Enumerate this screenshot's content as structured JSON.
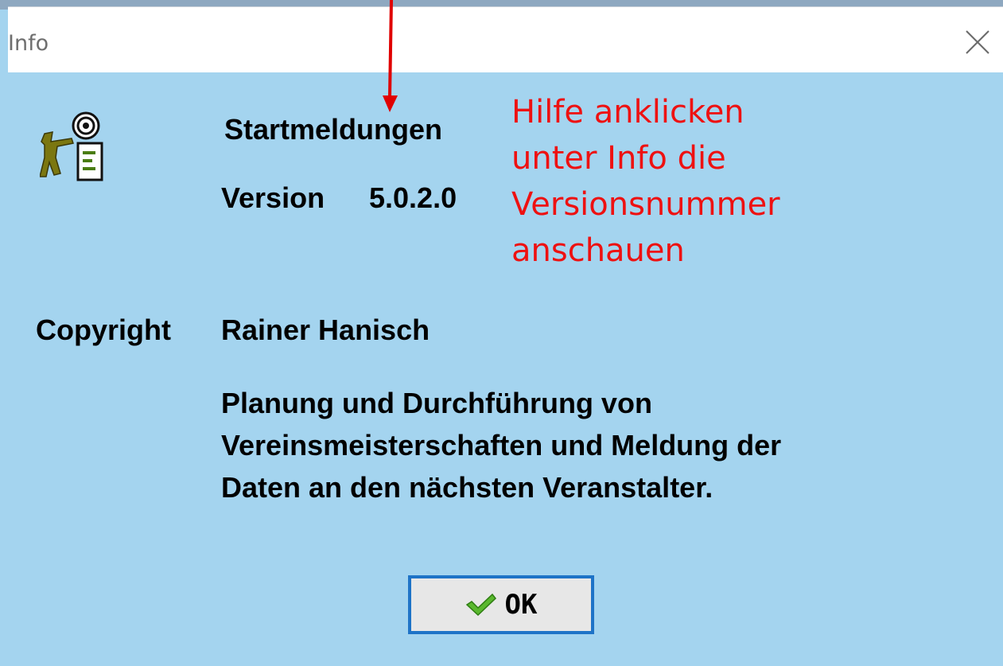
{
  "window": {
    "title": "Info"
  },
  "about": {
    "app_name": "Startmeldungen",
    "version_label": "Version",
    "version_number": "5.0.2.0",
    "copyright_label": "Copyright",
    "author": "Rainer Hanisch",
    "description_lines": [
      "Planung und Durchführung von",
      "Vereinsmeisterschaften und Meldung der",
      "Daten an den nächsten Veranstalter."
    ]
  },
  "annotation": {
    "lines": [
      "Hilfe anklicken",
      "unter Info die",
      "Versionsnummer",
      "anschauen"
    ],
    "color": "#ee1111"
  },
  "ok_button": {
    "label": "OK",
    "icon": "check-icon"
  },
  "colors": {
    "background": "#a4d4ef",
    "button_border": "#1e73c7"
  }
}
